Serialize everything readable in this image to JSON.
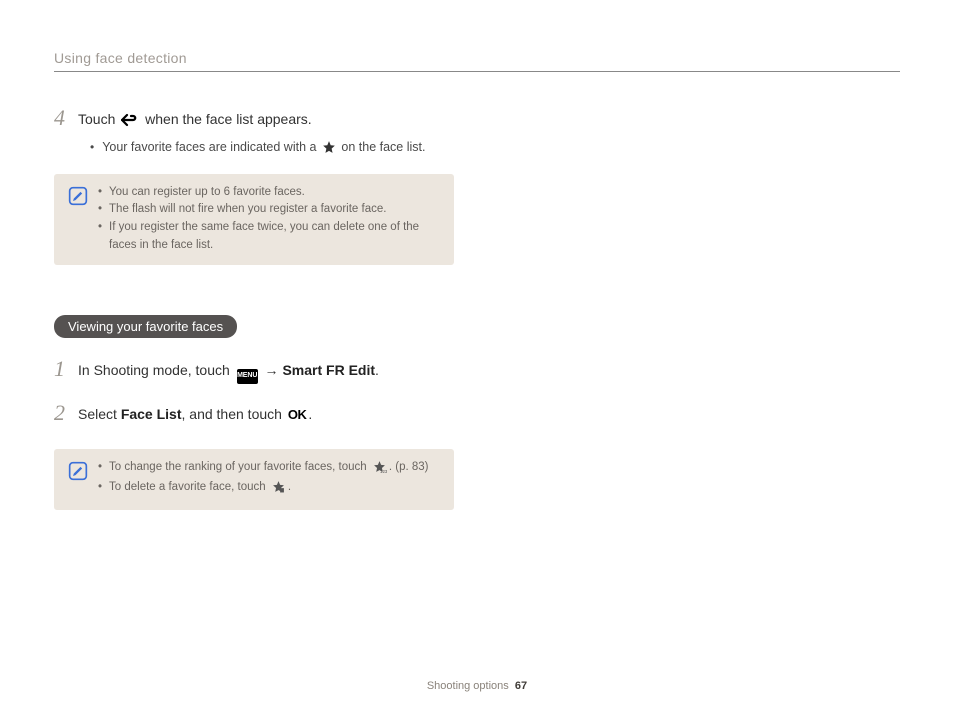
{
  "header_title": "Using face detection",
  "step4": {
    "num": "4",
    "before": "Touch ",
    "after": " when the face list appears."
  },
  "step4_sub": "Your favorite faces are indicated with a ",
  "step4_sub_after": " on the face list.",
  "note1": {
    "items": [
      "You can register up to 6 favorite faces.",
      "The flash will not fire when you register a favorite face.",
      "If you register the same face twice, you can delete one of the faces in the face list."
    ]
  },
  "section_pill": "Viewing your favorite faces",
  "step1": {
    "num": "1",
    "before": "In Shooting mode, touch ",
    "arrow": " → ",
    "bold": "Smart FR Edit",
    "end": "."
  },
  "step2": {
    "num": "2",
    "before": "Select ",
    "bold": "Face List",
    "mid": ", and then touch ",
    "end": "."
  },
  "note2": {
    "item1_before": "To change the ranking of your favorite faces, touch ",
    "item1_after": ". (p. 83)",
    "item2_before": "To delete a favorite face, touch ",
    "item2_after": "."
  },
  "footer_label": "Shooting options",
  "footer_page": "67",
  "icons": {
    "back": "back-arrow-icon",
    "star": "star-icon",
    "note": "note-pencil-icon",
    "menu": "MENU",
    "ok": "OK",
    "star123": "star-rank-icon",
    "star_delete": "star-delete-icon"
  }
}
